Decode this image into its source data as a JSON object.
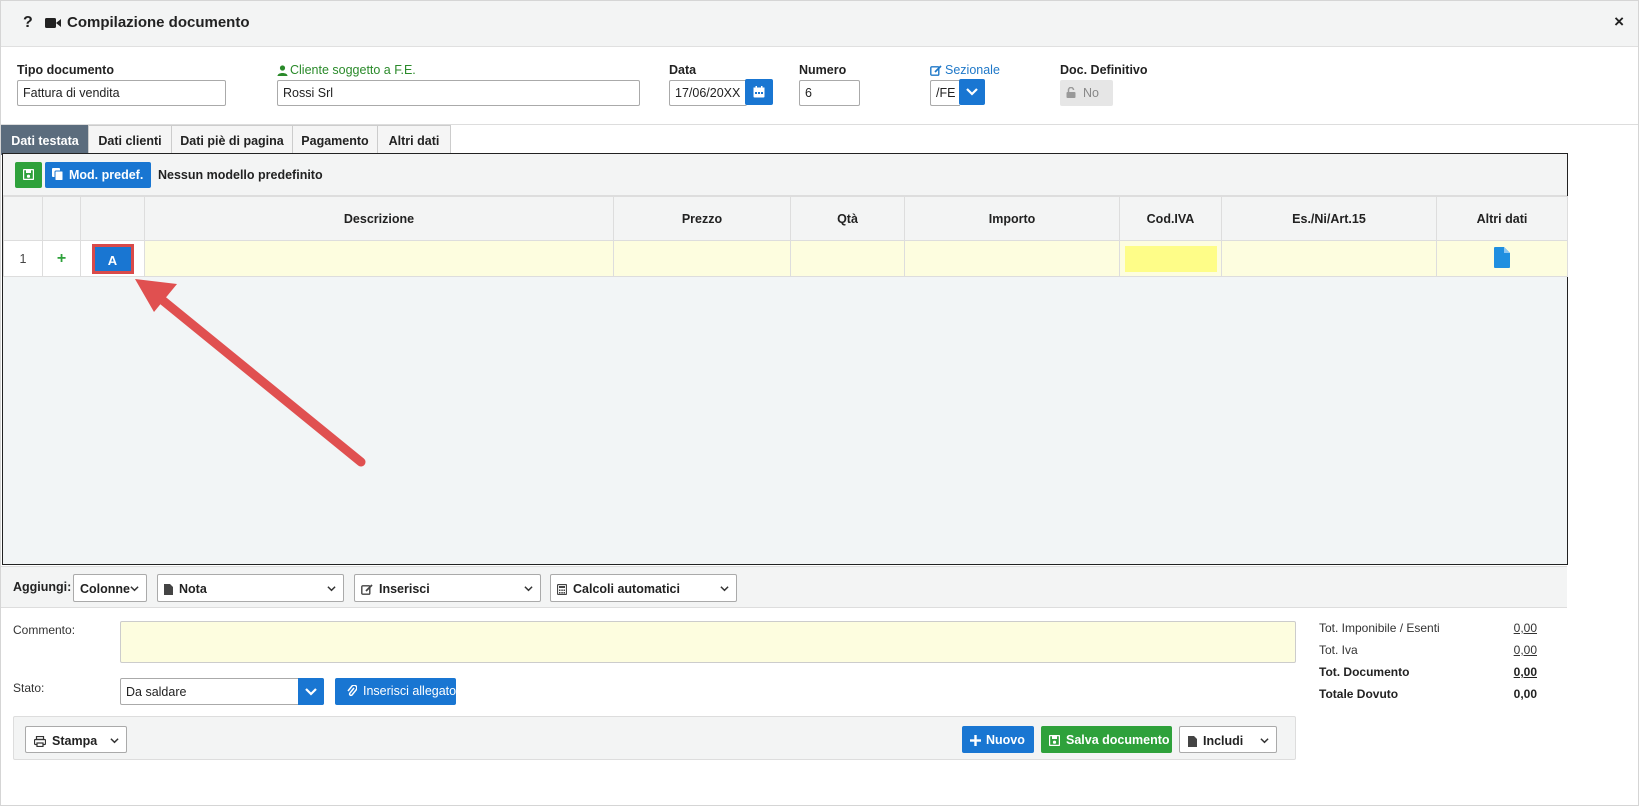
{
  "window": {
    "help_label": "?",
    "title": "Compilazione documento",
    "close_label": "×"
  },
  "header": {
    "tipo_documento": {
      "label": "Tipo documento",
      "value": "Fattura di vendita"
    },
    "cliente": {
      "label": "Cliente soggetto a F.E.",
      "value": "Rossi Srl"
    },
    "data": {
      "label": "Data",
      "value": "17/06/20XX"
    },
    "numero": {
      "label": "Numero",
      "value": "6"
    },
    "sezionale": {
      "label": "Sezionale",
      "value": "/FE"
    },
    "doc_definitivo": {
      "label": "Doc. Definitivo",
      "value": "No"
    }
  },
  "tabs": [
    {
      "label": "Dati testata",
      "active": true
    },
    {
      "label": "Dati clienti",
      "active": false
    },
    {
      "label": "Dati piè di pagina",
      "active": false
    },
    {
      "label": "Pagamento",
      "active": false
    },
    {
      "label": "Altri dati",
      "active": false
    }
  ],
  "toolbar": {
    "mod_predef_label": "Mod. predef.",
    "no_model_text": "Nessun modello predefinito"
  },
  "grid": {
    "columns": [
      "",
      "",
      "",
      "Descrizione",
      "Prezzo",
      "Qtà",
      "Importo",
      "Cod.IVA",
      "Es./Ni/Art.15",
      "Altri dati"
    ],
    "rows": [
      {
        "num": "1",
        "plus": "+",
        "type_button": "A",
        "descrizione": "",
        "prezzo": "",
        "qta": "",
        "importo": "",
        "cod_iva": "",
        "esenzione": ""
      }
    ]
  },
  "add_bar": {
    "label": "Aggiungi:",
    "colonne": "Colonne",
    "nota": "Nota",
    "inserisci": "Inserisci",
    "calcoli": "Calcoli automatici"
  },
  "footer": {
    "commento_label": "Commento:",
    "commento_value": "",
    "stato_label": "Stato:",
    "stato_value": "Da saldare",
    "allegato_label": "Inserisci allegato",
    "stampa_label": "Stampa",
    "nuovo_label": "Nuovo",
    "salva_label": "Salva documento",
    "includi_label": "Includi"
  },
  "totals": [
    {
      "label": "Tot. Imponibile / Esenti",
      "value": "0,00"
    },
    {
      "label": "Tot. Iva",
      "value": "0,00"
    },
    {
      "label": "Tot. Documento",
      "value": "0,00"
    },
    {
      "label": "Totale Dovuto",
      "value": "0,00"
    }
  ],
  "colors": {
    "primary_blue": "#1976d2",
    "success_green": "#2ea13b",
    "active_tab": "#5b6c7d",
    "row_yellow": "#fdfddf",
    "highlight_yellow": "#fefd88",
    "annotation_red": "#e05050"
  }
}
